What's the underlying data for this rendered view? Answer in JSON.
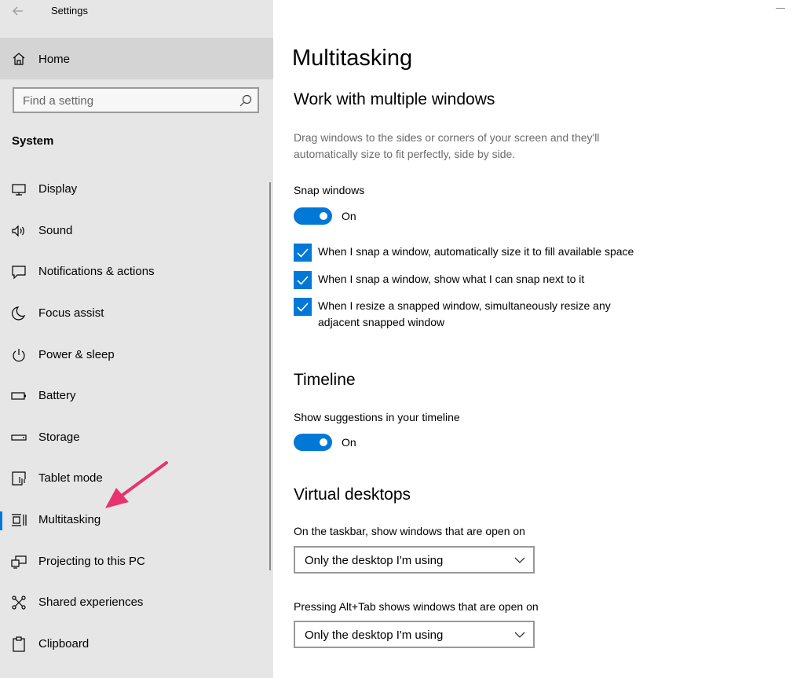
{
  "window": {
    "title": "Settings"
  },
  "sidebar": {
    "home_label": "Home",
    "search_placeholder": "Find a setting",
    "section_label": "System",
    "items": [
      {
        "label": "Display",
        "icon": "monitor-icon"
      },
      {
        "label": "Sound",
        "icon": "speaker-icon"
      },
      {
        "label": "Notifications & actions",
        "icon": "notification-icon"
      },
      {
        "label": "Focus assist",
        "icon": "moon-icon"
      },
      {
        "label": "Power & sleep",
        "icon": "power-icon"
      },
      {
        "label": "Battery",
        "icon": "battery-icon"
      },
      {
        "label": "Storage",
        "icon": "storage-icon"
      },
      {
        "label": "Tablet mode",
        "icon": "tablet-icon"
      },
      {
        "label": "Multitasking",
        "icon": "multitasking-icon",
        "selected": true
      },
      {
        "label": "Projecting to this PC",
        "icon": "projecting-icon"
      },
      {
        "label": "Shared experiences",
        "icon": "shared-icon"
      },
      {
        "label": "Clipboard",
        "icon": "clipboard-icon"
      }
    ]
  },
  "main": {
    "page_title": "Multitasking",
    "windows_section": {
      "heading": "Work with multiple windows",
      "description": "Drag windows to the sides or corners of your screen and they'll automatically size to fit perfectly, side by side.",
      "snap_label": "Snap windows",
      "snap_state": "On",
      "checkboxes": [
        {
          "label": "When I snap a window, automatically size it to fill available space",
          "checked": true
        },
        {
          "label": "When I snap a window, show what I can snap next to it",
          "checked": true
        },
        {
          "label": "When I resize a snapped window, simultaneously resize any adjacent snapped window",
          "checked": true
        }
      ]
    },
    "timeline_section": {
      "heading": "Timeline",
      "suggestions_label": "Show suggestions in your timeline",
      "suggestions_state": "On"
    },
    "virtual_desktops_section": {
      "heading": "Virtual desktops",
      "taskbar_label": "On the taskbar, show windows that are open on",
      "taskbar_value": "Only the desktop I'm using",
      "alttab_label": "Pressing Alt+Tab shows windows that are open on",
      "alttab_value": "Only the desktop I'm using"
    }
  },
  "colors": {
    "accent": "#0078d7",
    "sidebar_bg": "#e6e6e6",
    "annotation_arrow": "#e8336e"
  }
}
